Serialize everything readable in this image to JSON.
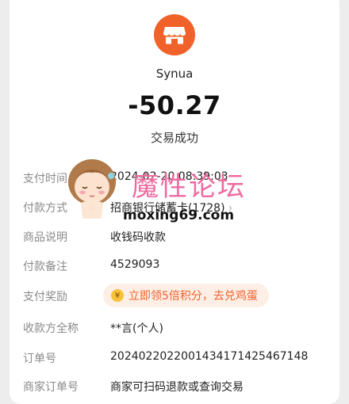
{
  "merchant": {
    "name": "Synua",
    "icon": "store-icon"
  },
  "transaction": {
    "amount": "-50.27",
    "status": "交易成功"
  },
  "details": {
    "pay_time": {
      "label": "支付时间",
      "value": "2024-02-20 08:39:03"
    },
    "pay_method": {
      "label": "付款方式",
      "value": "招商银行储蓄卡(1728)",
      "icon": "chevron-right-icon"
    },
    "goods_desc": {
      "label": "商品说明",
      "value": "收钱码收款"
    },
    "pay_note": {
      "label": "付款备注",
      "value": "4529093"
    },
    "pay_reward": {
      "label": "支付奖励",
      "value": "立即领5倍积分，去兑鸡蛋",
      "icon": "coin-icon"
    },
    "payee_name": {
      "label": "收款方全称",
      "value": "**言(个人)"
    },
    "order_no": {
      "label": "订单号",
      "value": "20240220220014341714254671​48"
    },
    "merchant_order": {
      "label": "商家订单号",
      "value": "商家可扫码退款或查询交易"
    }
  },
  "watermark": {
    "title": "魔性论坛",
    "url": "moxing69.com"
  },
  "colors": {
    "accent": "#f0622a",
    "watermark": "#f06aa0",
    "background": "#ededed"
  }
}
